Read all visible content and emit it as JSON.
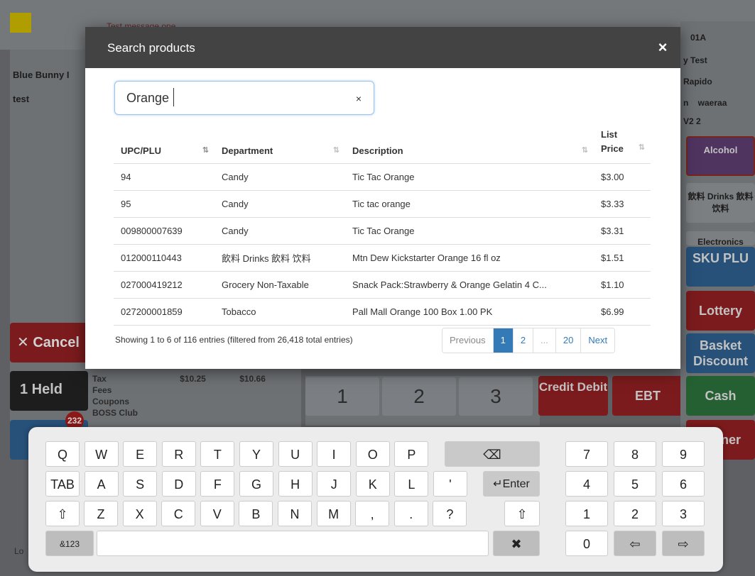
{
  "background": {
    "message": "Test message one",
    "left_rows": [
      "Blue Bunny I",
      "test"
    ],
    "cancel_label": "Cancel",
    "held_label": "1 Held",
    "badge_count": "232",
    "totals": {
      "tax_label": "Tax",
      "tax_a": "$10.25",
      "tax_b": "$10.66",
      "fees_label": "Fees",
      "coupons_label": "Coupons",
      "club_label": "BOSS Club"
    },
    "right_info": [
      "01A",
      "y Test",
      "Rapido",
      "n    waeraa",
      "V2 2"
    ],
    "right_buttons": [
      "Alcohol",
      "飲料 Drinks 飲料 饮料",
      "Electronics",
      "SKU PLU",
      "Lottery",
      "Basket Discount",
      "Cash",
      "ner"
    ],
    "numpad": [
      "1",
      "2",
      "3"
    ],
    "credit_label": "Credit Debit",
    "ebt_label": "EBT",
    "lo_label": "Lo"
  },
  "modal": {
    "title": "Search products",
    "close_icon": "×",
    "search_value": "Orange",
    "clear_icon": "×",
    "columns": [
      "UPC/PLU",
      "Department",
      "Description",
      "List Price"
    ],
    "rows": [
      [
        "94",
        "Candy",
        "Tic Tac Orange",
        "$3.00"
      ],
      [
        "95",
        "Candy",
        "Tic tac orange",
        "$3.33"
      ],
      [
        "009800007639",
        "Candy",
        "Tic Tac Orange",
        "$3.31"
      ],
      [
        "012000110443",
        "飲料 Drinks 飲料 饮料",
        "Mtn Dew Kickstarter Orange 16 fl oz",
        "$1.51"
      ],
      [
        "027000419212",
        "Grocery Non-Taxable",
        "Snack Pack:Strawberry & Orange Gelatin 4 C...",
        "$1.10"
      ],
      [
        "027200001859",
        "Tobacco",
        "Pall Mall Orange 100 Box 1.00 PK",
        "$6.99"
      ]
    ],
    "info": "Showing 1 to 6 of 116 entries (filtered from 26,418 total entries)",
    "pagination": [
      "Previous",
      "1",
      "2",
      "...",
      "20",
      "Next"
    ]
  },
  "keyboard": {
    "row1": [
      "Q",
      "W",
      "E",
      "R",
      "T",
      "Y",
      "U",
      "I",
      "O",
      "P"
    ],
    "backspace": "⌫",
    "row2": [
      "TAB",
      "A",
      "S",
      "D",
      "F",
      "G",
      "H",
      "J",
      "K",
      "L",
      "'"
    ],
    "enter": "↵Enter",
    "shift": "⇧",
    "row3": [
      "Z",
      "X",
      "C",
      "V",
      "B",
      "N",
      "M",
      ",",
      ".",
      "?"
    ],
    "sym": "&123",
    "close": "✖",
    "numpad": [
      "7",
      "8",
      "9",
      "4",
      "5",
      "6",
      "1",
      "2",
      "3",
      "0"
    ],
    "left_arrow": "⇦",
    "right_arrow": "⇨"
  }
}
